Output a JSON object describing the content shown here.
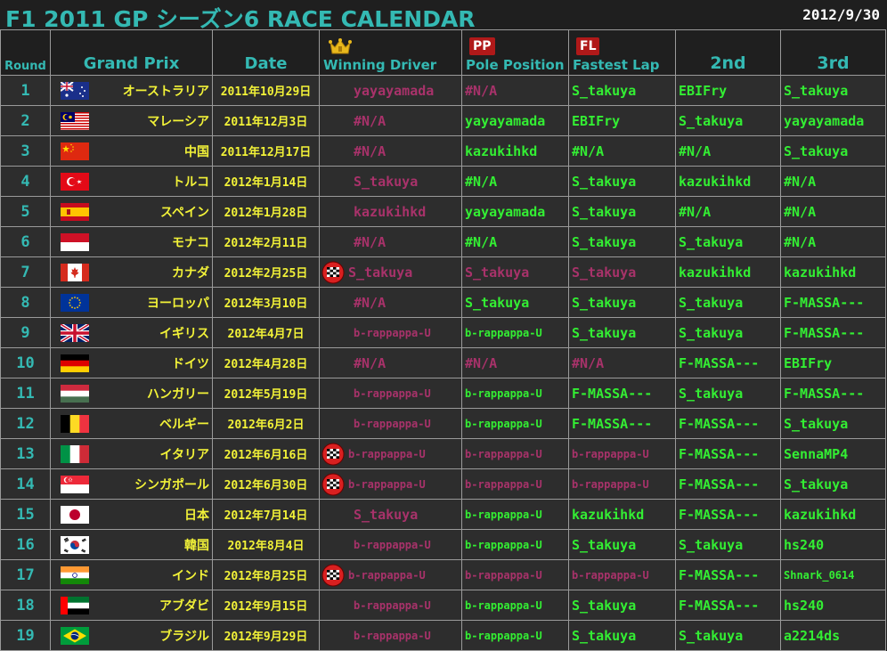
{
  "header": {
    "title": "F1 2011 GP シーズン6 RACE CALENDAR",
    "date": "2012/9/30"
  },
  "columns": {
    "round": "Round",
    "grand_prix": "Grand Prix",
    "date": "Date",
    "winning_driver": "Winning Driver",
    "pole_position": "Pole Position",
    "fastest_lap": "Fastest Lap",
    "second": "2nd",
    "third": "3rd",
    "pp_badge": "PP",
    "fl_badge": "FL"
  },
  "colors": {
    "accent": "#34b9b3",
    "gp_text": "#f2f238",
    "done": "#a8326a",
    "upcoming": "#33ee33",
    "badge": "#b01919"
  },
  "rows": [
    {
      "round": "1",
      "flag": "australia-flag-icon",
      "gp": "オーストラリア",
      "date": "2011年10月29日",
      "checkered": false,
      "winner": "yayayamada",
      "pole": "#N/A",
      "fastest": "S_takuya",
      "second": "EBIFry",
      "third": "S_takuya",
      "win_c": "pink",
      "pole_c": "pink",
      "fl_c": "green"
    },
    {
      "round": "2",
      "flag": "malaysia-flag-icon",
      "gp": "マレーシア",
      "date": "2011年12月3日",
      "checkered": false,
      "winner": "#N/A",
      "pole": "yayayamada",
      "fastest": "EBIFry",
      "second": "S_takuya",
      "third": "yayayamada",
      "win_c": "pink",
      "pole_c": "green",
      "fl_c": "green"
    },
    {
      "round": "3",
      "flag": "china-flag-icon",
      "gp": "中国",
      "date": "2011年12月17日",
      "checkered": false,
      "winner": "#N/A",
      "pole": "kazukihkd",
      "fastest": "#N/A",
      "second": "#N/A",
      "third": "S_takuya",
      "win_c": "pink",
      "pole_c": "green",
      "fl_c": "green"
    },
    {
      "round": "4",
      "flag": "turkey-flag-icon",
      "gp": "トルコ",
      "date": "2012年1月14日",
      "checkered": false,
      "winner": "S_takuya",
      "pole": "#N/A",
      "fastest": "S_takuya",
      "second": "kazukihkd",
      "third": "#N/A",
      "win_c": "pink",
      "pole_c": "green",
      "fl_c": "green"
    },
    {
      "round": "5",
      "flag": "spain-flag-icon",
      "gp": "スペイン",
      "date": "2012年1月28日",
      "checkered": false,
      "winner": "kazukihkd",
      "pole": "yayayamada",
      "fastest": "S_takuya",
      "second": "#N/A",
      "third": "#N/A",
      "win_c": "pink",
      "pole_c": "green",
      "fl_c": "green"
    },
    {
      "round": "6",
      "flag": "monaco-flag-icon",
      "gp": "モナコ",
      "date": "2012年2月11日",
      "checkered": false,
      "winner": "#N/A",
      "pole": "#N/A",
      "fastest": "S_takuya",
      "second": "S_takuya",
      "third": "#N/A",
      "win_c": "pink",
      "pole_c": "green",
      "fl_c": "green"
    },
    {
      "round": "7",
      "flag": "canada-flag-icon",
      "gp": "カナダ",
      "date": "2012年2月25日",
      "checkered": true,
      "winner": "S_takuya",
      "pole": "S_takuya",
      "fastest": "S_takuya",
      "second": "kazukihkd",
      "third": "kazukihkd",
      "win_c": "pink",
      "pole_c": "pink",
      "fl_c": "pink"
    },
    {
      "round": "8",
      "flag": "eu-flag-icon",
      "gp": "ヨーロッパ",
      "date": "2012年3月10日",
      "checkered": false,
      "winner": "#N/A",
      "pole": "S_takuya",
      "fastest": "S_takuya",
      "second": "S_takuya",
      "third": "F-MASSA---",
      "win_c": "pink",
      "pole_c": "green",
      "fl_c": "green"
    },
    {
      "round": "9",
      "flag": "uk-flag-icon",
      "gp": "イギリス",
      "date": "2012年4月7日",
      "checkered": false,
      "winner": "b-rappappa-U",
      "pole": "b-rappappa-U",
      "fastest": "S_takuya",
      "second": "S_takuya",
      "third": "F-MASSA---",
      "win_c": "pink",
      "pole_c": "green",
      "fl_c": "green"
    },
    {
      "round": "10",
      "flag": "germany-flag-icon",
      "gp": "ドイツ",
      "date": "2012年4月28日",
      "checkered": false,
      "winner": "#N/A",
      "pole": "#N/A",
      "fastest": "#N/A",
      "second": "F-MASSA---",
      "third": "EBIFry",
      "win_c": "pink",
      "pole_c": "pink",
      "fl_c": "pink"
    },
    {
      "round": "11",
      "flag": "hungary-flag-icon",
      "gp": "ハンガリー",
      "date": "2012年5月19日",
      "checkered": false,
      "winner": "b-rappappa-U",
      "pole": "b-rappappa-U",
      "fastest": "F-MASSA---",
      "second": "S_takuya",
      "third": "F-MASSA---",
      "win_c": "pink",
      "pole_c": "green",
      "fl_c": "green"
    },
    {
      "round": "12",
      "flag": "belgium-flag-icon",
      "gp": "ベルギー",
      "date": "2012年6月2日",
      "checkered": false,
      "winner": "b-rappappa-U",
      "pole": "b-rappappa-U",
      "fastest": "F-MASSA---",
      "second": "F-MASSA---",
      "third": "S_takuya",
      "win_c": "pink",
      "pole_c": "green",
      "fl_c": "green"
    },
    {
      "round": "13",
      "flag": "italy-flag-icon",
      "gp": "イタリア",
      "date": "2012年6月16日",
      "checkered": true,
      "winner": "b-rappappa-U",
      "pole": "b-rappappa-U",
      "fastest": "b-rappappa-U",
      "second": "F-MASSA---",
      "third": "SennaMP4",
      "win_c": "pink",
      "pole_c": "pink",
      "fl_c": "pink"
    },
    {
      "round": "14",
      "flag": "singapore-flag-icon",
      "gp": "シンガポール",
      "date": "2012年6月30日",
      "checkered": true,
      "winner": "b-rappappa-U",
      "pole": "b-rappappa-U",
      "fastest": "b-rappappa-U",
      "second": "F-MASSA---",
      "third": "S_takuya",
      "win_c": "pink",
      "pole_c": "pink",
      "fl_c": "pink"
    },
    {
      "round": "15",
      "flag": "japan-flag-icon",
      "gp": "日本",
      "date": "2012年7月14日",
      "checkered": false,
      "winner": "S_takuya",
      "pole": "b-rappappa-U",
      "fastest": "kazukihkd",
      "second": "F-MASSA---",
      "third": "kazukihkd",
      "win_c": "pink",
      "pole_c": "green",
      "fl_c": "green"
    },
    {
      "round": "16",
      "flag": "korea-flag-icon",
      "gp": "韓国",
      "date": "2012年8月4日",
      "checkered": false,
      "winner": "b-rappappa-U",
      "pole": "b-rappappa-U",
      "fastest": "S_takuya",
      "second": "S_takuya",
      "third": "hs240",
      "win_c": "pink",
      "pole_c": "green",
      "fl_c": "green"
    },
    {
      "round": "17",
      "flag": "india-flag-icon",
      "gp": "インド",
      "date": "2012年8月25日",
      "checkered": true,
      "winner": "b-rappappa-U",
      "pole": "b-rappappa-U",
      "fastest": "b-rappappa-U",
      "second": "F-MASSA---",
      "third": "Shnark_0614",
      "win_c": "pink",
      "pole_c": "pink",
      "fl_c": "pink"
    },
    {
      "round": "18",
      "flag": "uae-flag-icon",
      "gp": "アブダビ",
      "date": "2012年9月15日",
      "checkered": false,
      "winner": "b-rappappa-U",
      "pole": "b-rappappa-U",
      "fastest": "S_takuya",
      "second": "F-MASSA---",
      "third": "hs240",
      "win_c": "pink",
      "pole_c": "green",
      "fl_c": "green"
    },
    {
      "round": "19",
      "flag": "brazil-flag-icon",
      "gp": "ブラジル",
      "date": "2012年9月29日",
      "checkered": false,
      "winner": "b-rappappa-U",
      "pole": "b-rappappa-U",
      "fastest": "S_takuya",
      "second": "S_takuya",
      "third": "a2214ds",
      "win_c": "pink",
      "pole_c": "green",
      "fl_c": "green"
    }
  ]
}
